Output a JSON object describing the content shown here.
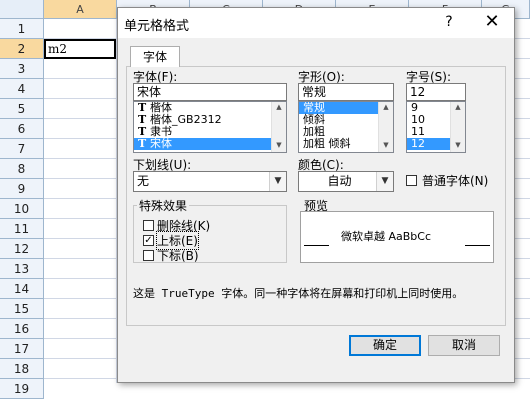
{
  "sheet": {
    "columns": [
      "A",
      "B",
      "C",
      "D",
      "E",
      "F",
      "G"
    ],
    "rows": [
      "1",
      "2",
      "3",
      "4",
      "5",
      "6",
      "7",
      "8",
      "9",
      "10",
      "11",
      "12",
      "13",
      "14",
      "15",
      "16",
      "17",
      "18",
      "19"
    ],
    "cell_a2": "m2"
  },
  "dialog": {
    "title": "单元格格式",
    "help": "?",
    "close": "✕",
    "tab": "字体",
    "font": {
      "label": "字体(F):",
      "value": "宋体",
      "items": [
        {
          "icon": "T",
          "name": "楷体"
        },
        {
          "icon": "T",
          "name": "楷体_GB2312"
        },
        {
          "icon": "T",
          "name": "隶书"
        },
        {
          "icon": "T",
          "name": "宋体"
        }
      ]
    },
    "style": {
      "label": "字形(O):",
      "value": "常规",
      "items": [
        "常规",
        "倾斜",
        "加粗",
        "加粗 倾斜"
      ]
    },
    "size": {
      "label": "字号(S):",
      "value": "12",
      "items": [
        "9",
        "10",
        "11",
        "12"
      ]
    },
    "underline": {
      "label": "下划线(U):",
      "value": "无"
    },
    "color": {
      "label": "颜色(C):",
      "value": "自动"
    },
    "normal_font": "普通字体(N)",
    "effects": {
      "title": "特殊效果",
      "strikethrough": "删除线(K)",
      "superscript": "上标(E)",
      "subscript": "下标(B)",
      "superscript_checked": "✓"
    },
    "preview": {
      "title": "预览",
      "sample": "微软卓越  AaBbCc"
    },
    "info": "这是 TrueType 字体。同一种字体将在屏幕和打印机上同时使用。",
    "ok": "确定",
    "cancel": "取消"
  }
}
